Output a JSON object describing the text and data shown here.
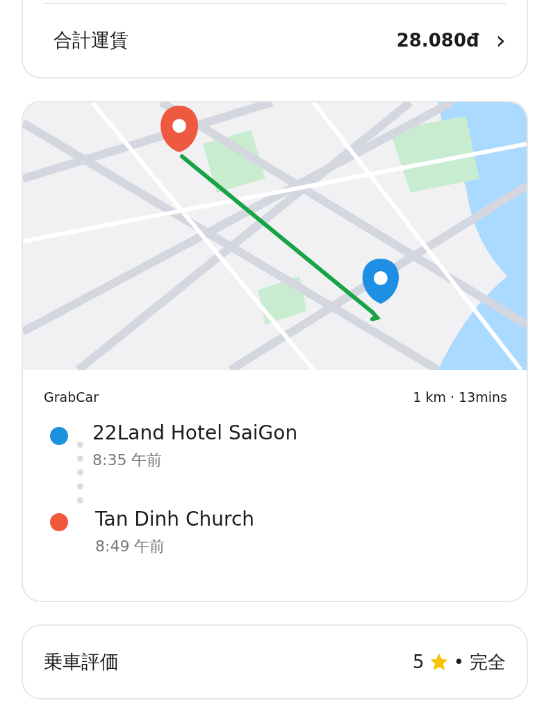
{
  "fare_card": {
    "label": "合計運賃",
    "amount": "28.080đ",
    "chevron": "›"
  },
  "trip_card": {
    "service": "GrabCar",
    "summary": "1 km · 13mins",
    "stops": [
      {
        "kind": "pickup",
        "color": "#1e90e0",
        "name": "22Land Hotel SaiGon",
        "time": "8:35 午前"
      },
      {
        "kind": "dropoff",
        "color": "#f0583a",
        "name": "Tan Dinh Church",
        "time": "8:49 午前"
      }
    ]
  },
  "rating_card": {
    "label": "乗車評価",
    "value": "5",
    "separator": "•",
    "result": "完全"
  }
}
